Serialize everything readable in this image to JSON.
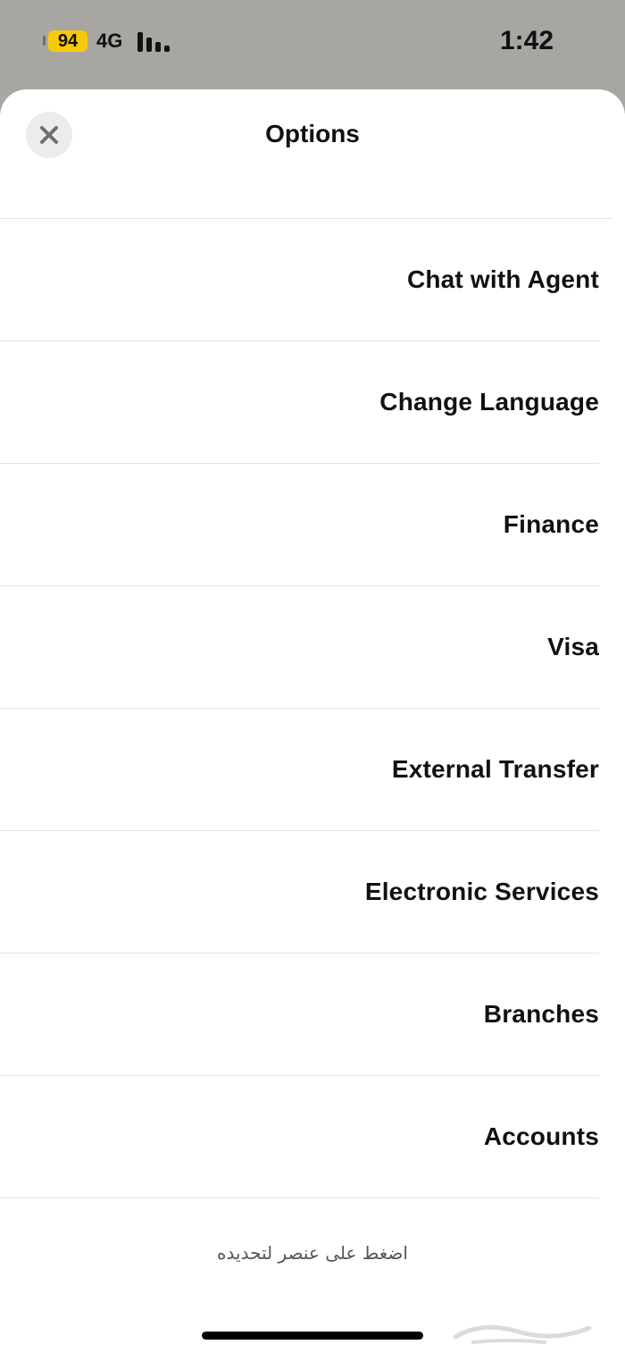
{
  "status_bar": {
    "battery": "94",
    "network": "4G",
    "time": "1:42"
  },
  "sheet": {
    "title": "Options",
    "close_icon": "close-icon",
    "items": [
      {
        "label": "Chat with Agent"
      },
      {
        "label": "Change Language"
      },
      {
        "label": "Finance"
      },
      {
        "label": "Visa"
      },
      {
        "label": "External Transfer"
      },
      {
        "label": "Electronic Services"
      },
      {
        "label": "Branches"
      },
      {
        "label": "Accounts"
      }
    ],
    "hint": "اضغط على عنصر لتحديده"
  },
  "colors": {
    "battery": "#f7c90b",
    "background_dim": "#a8a6a2",
    "sheet": "#ffffff",
    "divider": "#e3e3e3"
  },
  "watermark": "حراج"
}
